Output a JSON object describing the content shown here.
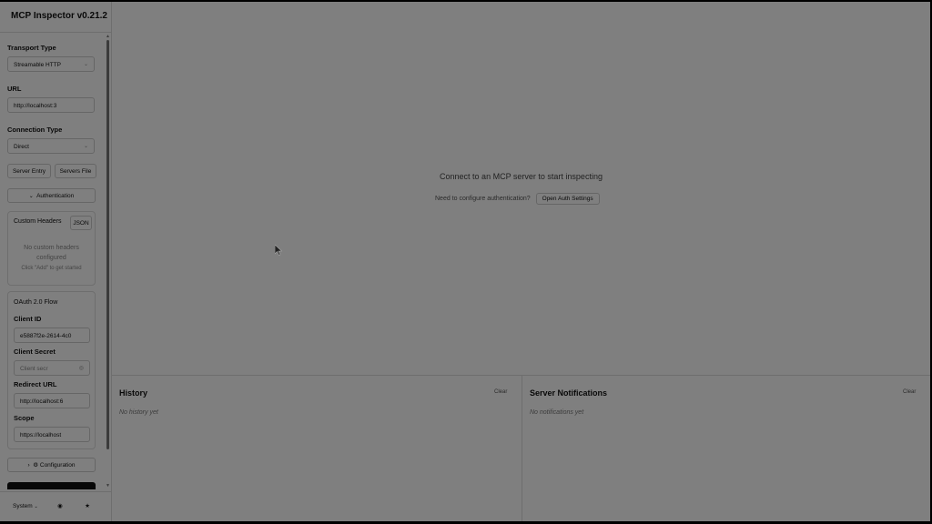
{
  "app": {
    "title": "MCP Inspector v0.21.2"
  },
  "sidebar": {
    "transport_type": {
      "label": "Transport Type",
      "value": "Streamable HTTP"
    },
    "url": {
      "label": "URL",
      "value": "http://localhost:3"
    },
    "connection_type": {
      "label": "Connection Type",
      "value": "Direct"
    },
    "server_entry_button": "Server Entry",
    "servers_file_button": "Servers File",
    "authentication_toggle": "Authentication",
    "custom_headers": {
      "label": "Custom Headers",
      "json_button": "JSON",
      "empty_line1": "No custom headers",
      "empty_line2": "configured",
      "hint": "Click \"Add\" to get started"
    },
    "oauth": {
      "title": "OAuth 2.0 Flow",
      "client_id": {
        "label": "Client ID",
        "value": "e5887f2e-2614-4c0"
      },
      "client_secret": {
        "label": "Client Secret",
        "placeholder": "Client secr"
      },
      "redirect_url": {
        "label": "Redirect URL",
        "value": "http://localhost:6"
      },
      "scope": {
        "label": "Scope",
        "value": "https://localhost"
      }
    },
    "configuration_toggle": "Configuration",
    "footer": {
      "theme_select": "System"
    }
  },
  "main": {
    "connect_prompt": "Connect to an MCP server to start inspecting",
    "auth_prompt": "Need to configure authentication?",
    "open_auth_button": "Open Auth Settings"
  },
  "history": {
    "title": "History",
    "clear": "Clear",
    "empty": "No history yet"
  },
  "notifications": {
    "title": "Server Notifications",
    "clear": "Clear",
    "empty": "No notifications yet"
  }
}
